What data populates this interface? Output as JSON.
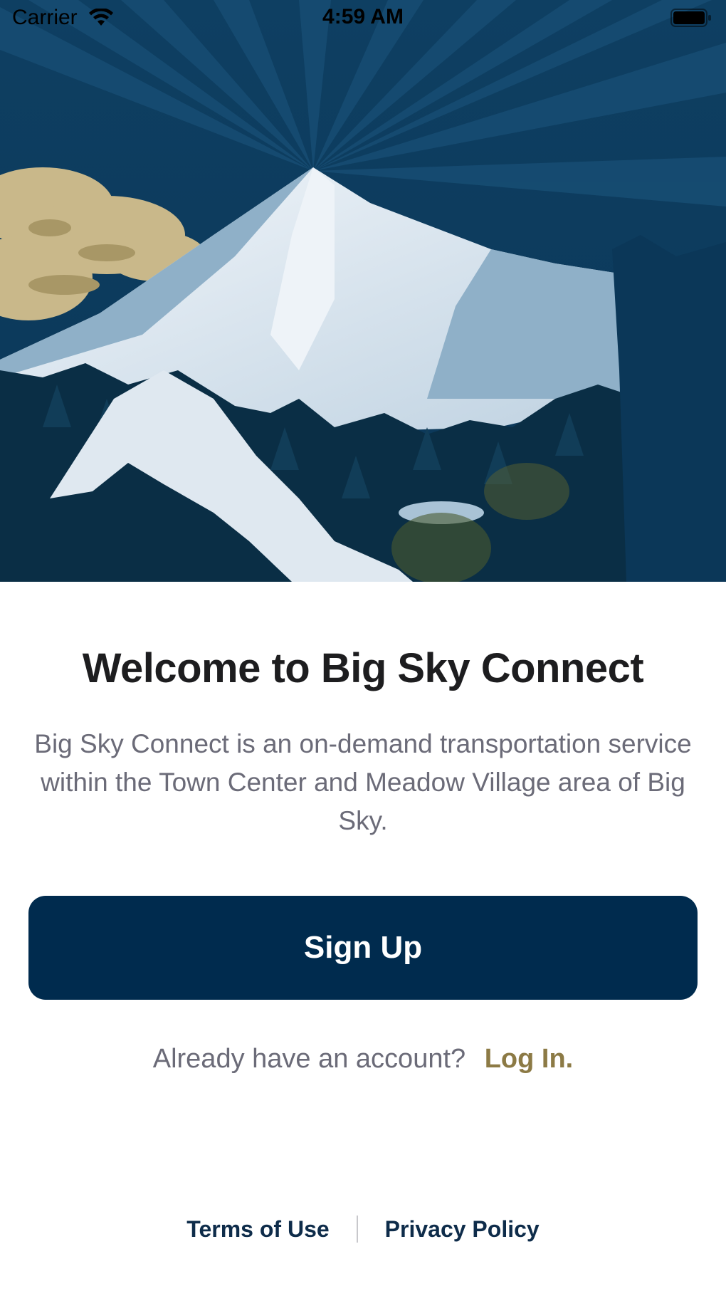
{
  "status_bar": {
    "carrier": "Carrier",
    "time": "4:59 AM",
    "icons": [
      "wifi-icon",
      "battery-icon"
    ]
  },
  "hero": {
    "image": "mountain-illustration",
    "colors": {
      "sky": "#0b3a5c",
      "snow": "#e6eef5",
      "forest": "#0a2e45",
      "cloud": "#c9b88a"
    }
  },
  "welcome": {
    "title": "Welcome to Big Sky Connect",
    "description": "Big Sky Connect is an on-demand transportation service within the Town Center and Meadow Village area of Big Sky."
  },
  "actions": {
    "signup_label": "Sign Up",
    "login_prompt": "Already have an account?",
    "login_link": "Log In."
  },
  "footer": {
    "terms": "Terms of Use",
    "privacy": "Privacy Policy"
  },
  "colors": {
    "primary": "#002b4e",
    "accent": "#8c7a45",
    "text_secondary": "#6b6b78"
  }
}
